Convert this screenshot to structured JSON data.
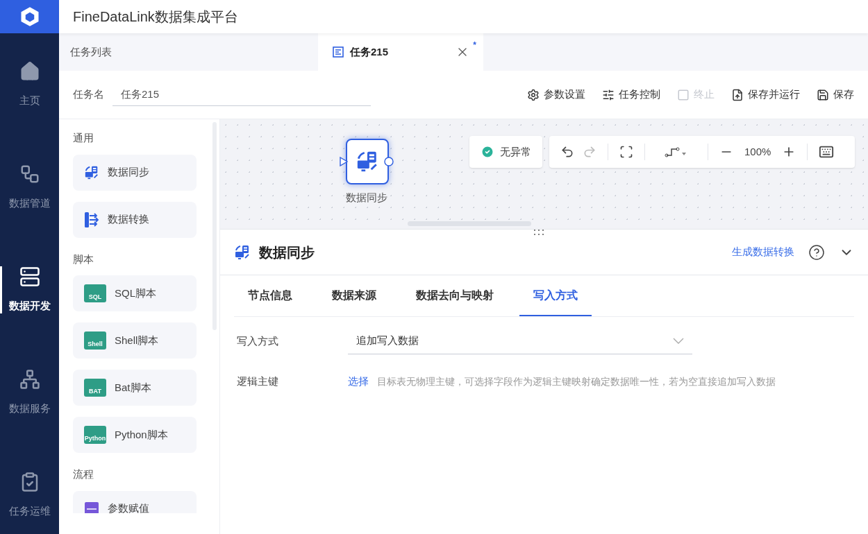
{
  "app": {
    "title": "FineDataLink数据集成平台"
  },
  "nav": [
    {
      "label": "主页",
      "selected": false
    },
    {
      "label": "数据管道",
      "selected": false
    },
    {
      "label": "数据开发",
      "selected": true
    },
    {
      "label": "数据服务",
      "selected": false
    },
    {
      "label": "任务运维",
      "selected": false
    }
  ],
  "tabs": [
    {
      "label": "任务列表",
      "selected": false
    },
    {
      "label": "任务215",
      "selected": true,
      "closable": true,
      "modified_mark": "*"
    }
  ],
  "task_name": {
    "label": "任务名",
    "value": "任务215"
  },
  "toolbar": [
    {
      "label": "参数设置",
      "disabled": false
    },
    {
      "label": "任务控制",
      "disabled": false
    },
    {
      "label": "终止",
      "disabled": true
    },
    {
      "label": "保存并运行",
      "disabled": false
    },
    {
      "label": "保存",
      "disabled": false
    }
  ],
  "palette": [
    {
      "title": "通用",
      "items": [
        {
          "label": "数据同步",
          "kind": "sync"
        },
        {
          "label": "数据转换",
          "kind": "transform"
        }
      ]
    },
    {
      "title": "脚本",
      "items": [
        {
          "label": "SQL脚本",
          "kind": "script",
          "badge": "SQL"
        },
        {
          "label": "Shell脚本",
          "kind": "script",
          "badge": "Shell"
        },
        {
          "label": "Bat脚本",
          "kind": "script",
          "badge": "BAT"
        },
        {
          "label": "Python脚本",
          "kind": "script",
          "badge": "Python"
        }
      ]
    },
    {
      "title": "流程",
      "items": [
        {
          "label": "参数赋值",
          "kind": "param"
        }
      ]
    }
  ],
  "canvas": {
    "node": {
      "label": "数据同步",
      "selected": true
    },
    "status": "无异常",
    "zoom": "100%"
  },
  "panel": {
    "title": "数据同步",
    "link": "生成数据转换",
    "tabs": [
      {
        "label": "节点信息",
        "selected": false
      },
      {
        "label": "数据来源",
        "selected": false
      },
      {
        "label": "数据去向与映射",
        "selected": false
      },
      {
        "label": "写入方式",
        "selected": true
      }
    ],
    "write_mode": {
      "label": "写入方式",
      "value": "追加写入数据"
    },
    "logical_key": {
      "label": "逻辑主键",
      "link": "选择",
      "hint": "目标表无物理主键，可选择字段作为逻辑主键映射确定数据唯一性，若为空直接追加写入数据"
    }
  }
}
